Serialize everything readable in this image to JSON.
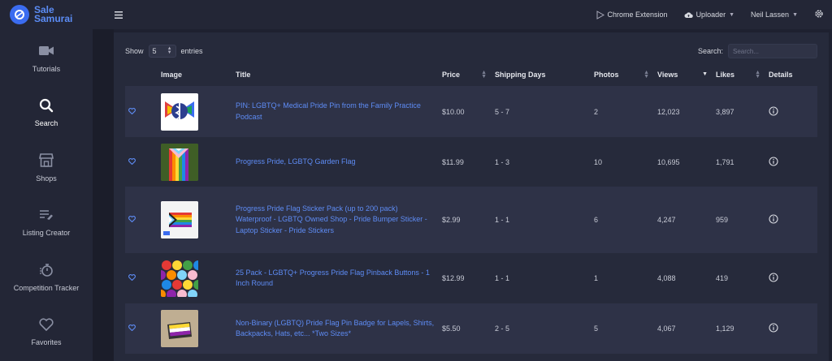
{
  "brand": {
    "line1": "Sale",
    "line2": "Samurai"
  },
  "topbar": {
    "chrome_extension": "Chrome Extension",
    "uploader": "Uploader",
    "user": "Neil Lassen"
  },
  "sidebar": {
    "items": [
      {
        "label": "Tutorials",
        "icon": "video-camera-icon"
      },
      {
        "label": "Search",
        "icon": "search-icon"
      },
      {
        "label": "Shops",
        "icon": "shop-icon"
      },
      {
        "label": "Listing Creator",
        "icon": "list-edit-icon"
      },
      {
        "label": "Competition Tracker",
        "icon": "stopwatch-icon"
      },
      {
        "label": "Favorites",
        "icon": "heart-icon"
      }
    ]
  },
  "controls": {
    "show_label": "Show",
    "entries_value": "5",
    "entries_label": "entries",
    "search_label": "Search:",
    "search_placeholder": "Search..."
  },
  "table": {
    "headers": {
      "image": "Image",
      "title": "Title",
      "price": "Price",
      "shipping": "Shipping Days",
      "photos": "Photos",
      "views": "Views",
      "likes": "Likes",
      "details": "Details"
    },
    "rows": [
      {
        "title": "PIN: LGBTQ+ Medical Pride Pin from the Family Practice Podcast",
        "price": "$10.00",
        "shipping": "5 - 7",
        "photos": "2",
        "views": "12,023",
        "likes": "3,897"
      },
      {
        "title": "Progress Pride, LGBTQ Garden Flag",
        "price": "$11.99",
        "shipping": "1 - 3",
        "photos": "10",
        "views": "10,695",
        "likes": "1,791"
      },
      {
        "title": "Progress Pride Flag Sticker Pack (up to 200 pack) Waterproof - LGBTQ Owned Shop - Pride Bumper Sticker - Laptop Sticker - Pride Stickers",
        "price": "$2.99",
        "shipping": "1 - 1",
        "photos": "6",
        "views": "4,247",
        "likes": "959"
      },
      {
        "title": "25 Pack - LGBTQ+ Progress Pride Flag Pinback Buttons - 1 Inch Round",
        "price": "$12.99",
        "shipping": "1 - 1",
        "photos": "1",
        "views": "4,088",
        "likes": "419"
      },
      {
        "title": "Non-Binary (LGBTQ) Pride Flag Pin Badge for Lapels, Shirts, Backpacks, Hats, etc... *Two Sizes*",
        "price": "$5.50",
        "shipping": "2 - 5",
        "photos": "5",
        "views": "4,067",
        "likes": "1,129"
      }
    ]
  },
  "colors": {
    "accent": "#5e8cf5",
    "background": "#1e2130",
    "panel": "#262a3b",
    "row_alt": "#2e3247"
  }
}
